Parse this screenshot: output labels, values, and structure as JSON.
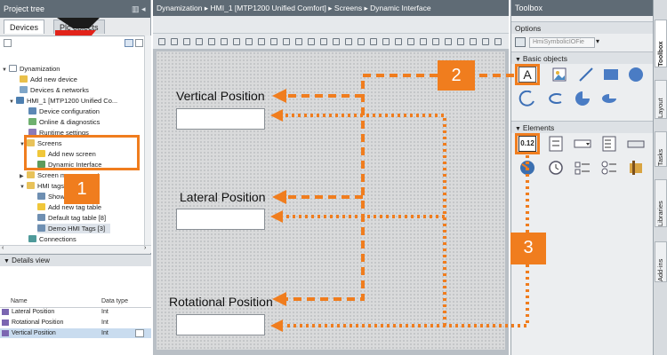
{
  "left_pane": {
    "title": "Project tree",
    "tab_devices": "Devices",
    "tab_plc": "Plc objects",
    "tree": [
      {
        "label": "Dynamization"
      },
      {
        "label": "Add new device"
      },
      {
        "label": "Devices & networks"
      },
      {
        "label": "HMI_1 [MTP1200 Unified Co..."
      },
      {
        "label": "Device configuration"
      },
      {
        "label": "Online & diagnostics"
      },
      {
        "label": "Runtime settings"
      },
      {
        "label": "Screens"
      },
      {
        "label": "Add new screen"
      },
      {
        "label": "Dynamic Interface"
      },
      {
        "label": "Screen management"
      },
      {
        "label": "HMI tags"
      },
      {
        "label": "Show all tags"
      },
      {
        "label": "Add new tag table"
      },
      {
        "label": "Default tag table [8]"
      },
      {
        "label": "Demo HMI Tags [3]"
      },
      {
        "label": "Connections"
      }
    ],
    "details_title": "Details view",
    "details_cols": {
      "name": "Name",
      "type": "Data type"
    },
    "details_rows": [
      {
        "name": "Lateral Position",
        "type": "Int"
      },
      {
        "name": "Rotational Position",
        "type": "Int"
      },
      {
        "name": "Vertical Position",
        "type": "Int"
      }
    ]
  },
  "breadcrumb": {
    "project": "Dynamization",
    "device": "HMI_1 [MTP1200 Unified Comfort]",
    "folder": "Screens",
    "screen": "Dynamic Interface"
  },
  "canvas": {
    "vertical_label": "Vertical Position",
    "lateral_label": "Lateral Position",
    "rotational_label": "Rotational Position"
  },
  "toolbox": {
    "title": "Toolbox",
    "options": "Options",
    "options_select": "HmiSymbolicIOFie",
    "basic_objects": "Basic objects",
    "elements": "Elements",
    "io_field_text": "0.12",
    "text_tool_glyph": "A"
  },
  "side_tabs": {
    "toolbox": "Toolbox",
    "layout": "Layout",
    "tasks": "Tasks",
    "libraries": "Libraries",
    "addins": "Add-ins"
  },
  "annotations": {
    "badge1": "1",
    "badge2": "2",
    "badge3": "3"
  },
  "colors": {
    "accent": "#f07d1e",
    "header": "#5f6b75"
  }
}
